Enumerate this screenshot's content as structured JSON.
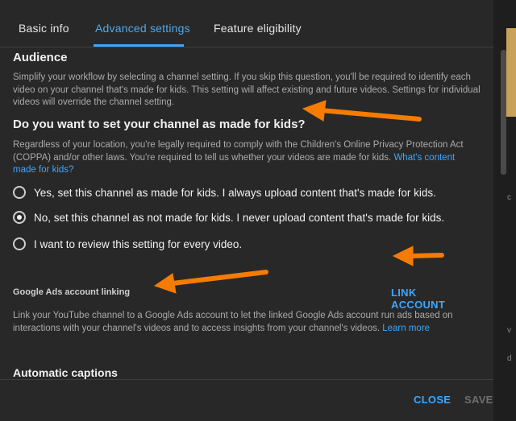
{
  "tabs": [
    {
      "label": "Basic info",
      "active": false
    },
    {
      "label": "Advanced settings",
      "active": true
    },
    {
      "label": "Feature eligibility",
      "active": false
    }
  ],
  "audience": {
    "title": "Audience",
    "description": "Simplify your workflow by selecting a channel setting. If you skip this question, you'll be required to identify each video on your channel that's made for kids. This setting will affect existing and future videos. Settings for individual videos will override the channel setting.",
    "question": "Do you want to set your channel as made for kids?",
    "legal_text": "Regardless of your location, you're legally required to comply with the Children's Online Privacy Protection Act (COPPA) and/or other laws. You're required to tell us whether your videos are made for kids.",
    "legal_link": "What's content made for kids?",
    "options": [
      {
        "label": "Yes, set this channel as made for kids. I always upload content that's made for kids.",
        "checked": false
      },
      {
        "label": "No, set this channel as not made for kids. I never upload content that's made for kids.",
        "checked": true
      },
      {
        "label": "I want to review this setting for every video.",
        "checked": false
      }
    ]
  },
  "ads": {
    "title": "Google Ads account linking",
    "button": "LINK ACCOUNT",
    "description": "Link your YouTube channel to a Google Ads account to let the linked Google Ads account run ads based on interactions with your channel's videos and to access insights from your channel's videos.",
    "link": "Learn more"
  },
  "captions": {
    "title": "Automatic captions"
  },
  "footer": {
    "close": "CLOSE",
    "save": "SAVE"
  },
  "colors": {
    "accent": "#3ea6ff",
    "arrow": "#f57c00",
    "background": "#282828"
  }
}
